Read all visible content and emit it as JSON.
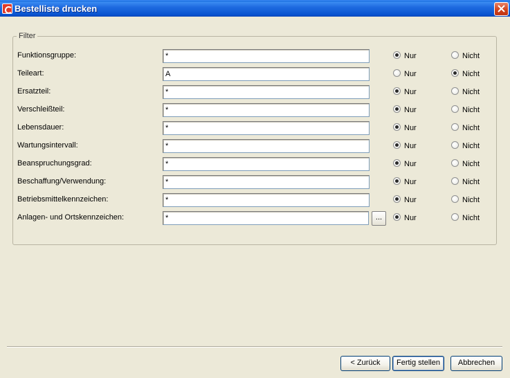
{
  "window": {
    "title": "Bestelliste drucken"
  },
  "filter": {
    "legend": "Filter",
    "nur_label": "Nur",
    "nicht_label": "Nicht",
    "rows": [
      {
        "label": "Funktionsgruppe:",
        "value": "*",
        "selected": "Nur"
      },
      {
        "label": "Teileart:",
        "value": "A",
        "selected": "Nicht"
      },
      {
        "label": "Ersatzteil:",
        "value": "*",
        "selected": "Nur"
      },
      {
        "label": "Verschleißteil:",
        "value": "*",
        "selected": "Nur"
      },
      {
        "label": "Lebensdauer:",
        "value": "*",
        "selected": "Nur"
      },
      {
        "label": "Wartungsintervall:",
        "value": "*",
        "selected": "Nur"
      },
      {
        "label": "Beanspruchungsgrad:",
        "value": "*",
        "selected": "Nur"
      },
      {
        "label": "Beschaffung/Verwendung:",
        "value": "*",
        "selected": "Nur"
      },
      {
        "label": "Betriebsmittelkennzeichen:",
        "value": "*",
        "selected": "Nur"
      },
      {
        "label": "Anlagen- und Ortskennzeichen:",
        "value": "*",
        "selected": "Nur"
      }
    ],
    "browse_label": "..."
  },
  "buttons": {
    "back": "< Zurück",
    "finish": "Fertig stellen",
    "cancel": "Abbrechen"
  }
}
